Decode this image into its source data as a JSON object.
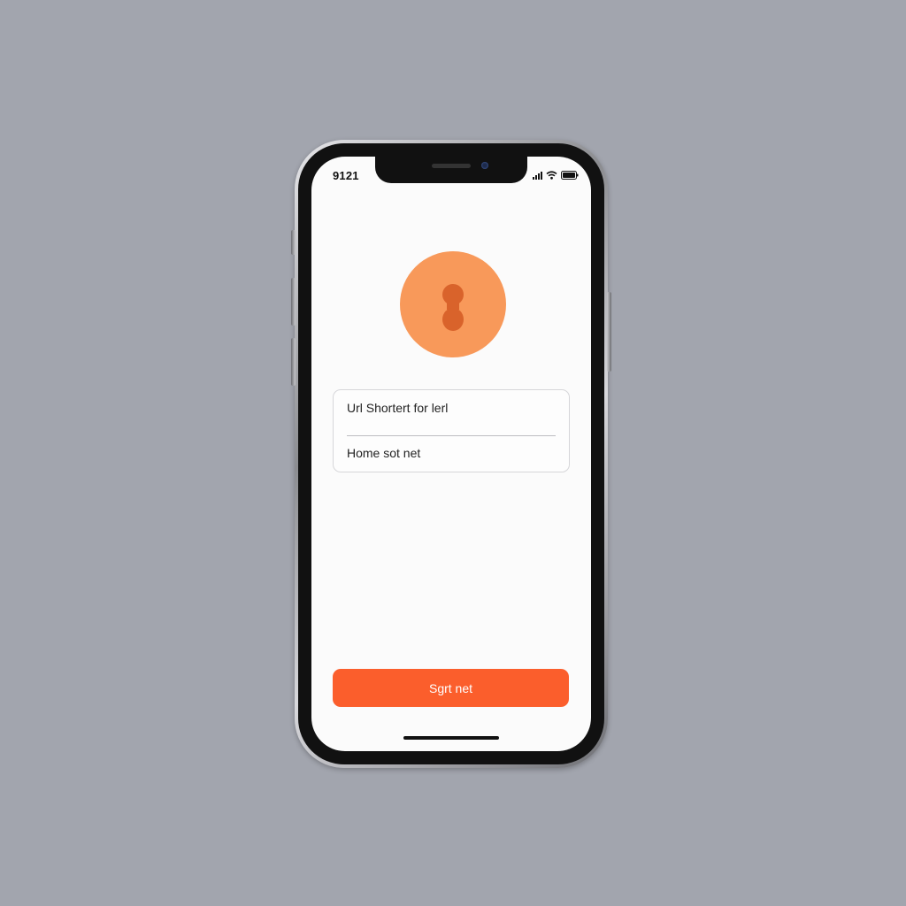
{
  "status_bar": {
    "time": "9121",
    "icons": [
      "signal-icon",
      "wifi-icon",
      "battery-icon"
    ]
  },
  "app": {
    "logo": {
      "icon": "keyhole-icon",
      "circle_color": "#f8995a",
      "glyph_color": "#d9632b"
    },
    "form": {
      "url_field_value": "Url Shortert for lerl",
      "home_field_value": "Home sot net"
    },
    "primary_button": {
      "label": "Sgrt net",
      "color": "#fb5e2c"
    }
  },
  "colors": {
    "background": "#a2a5ae",
    "screen": "#fbfbfb"
  }
}
